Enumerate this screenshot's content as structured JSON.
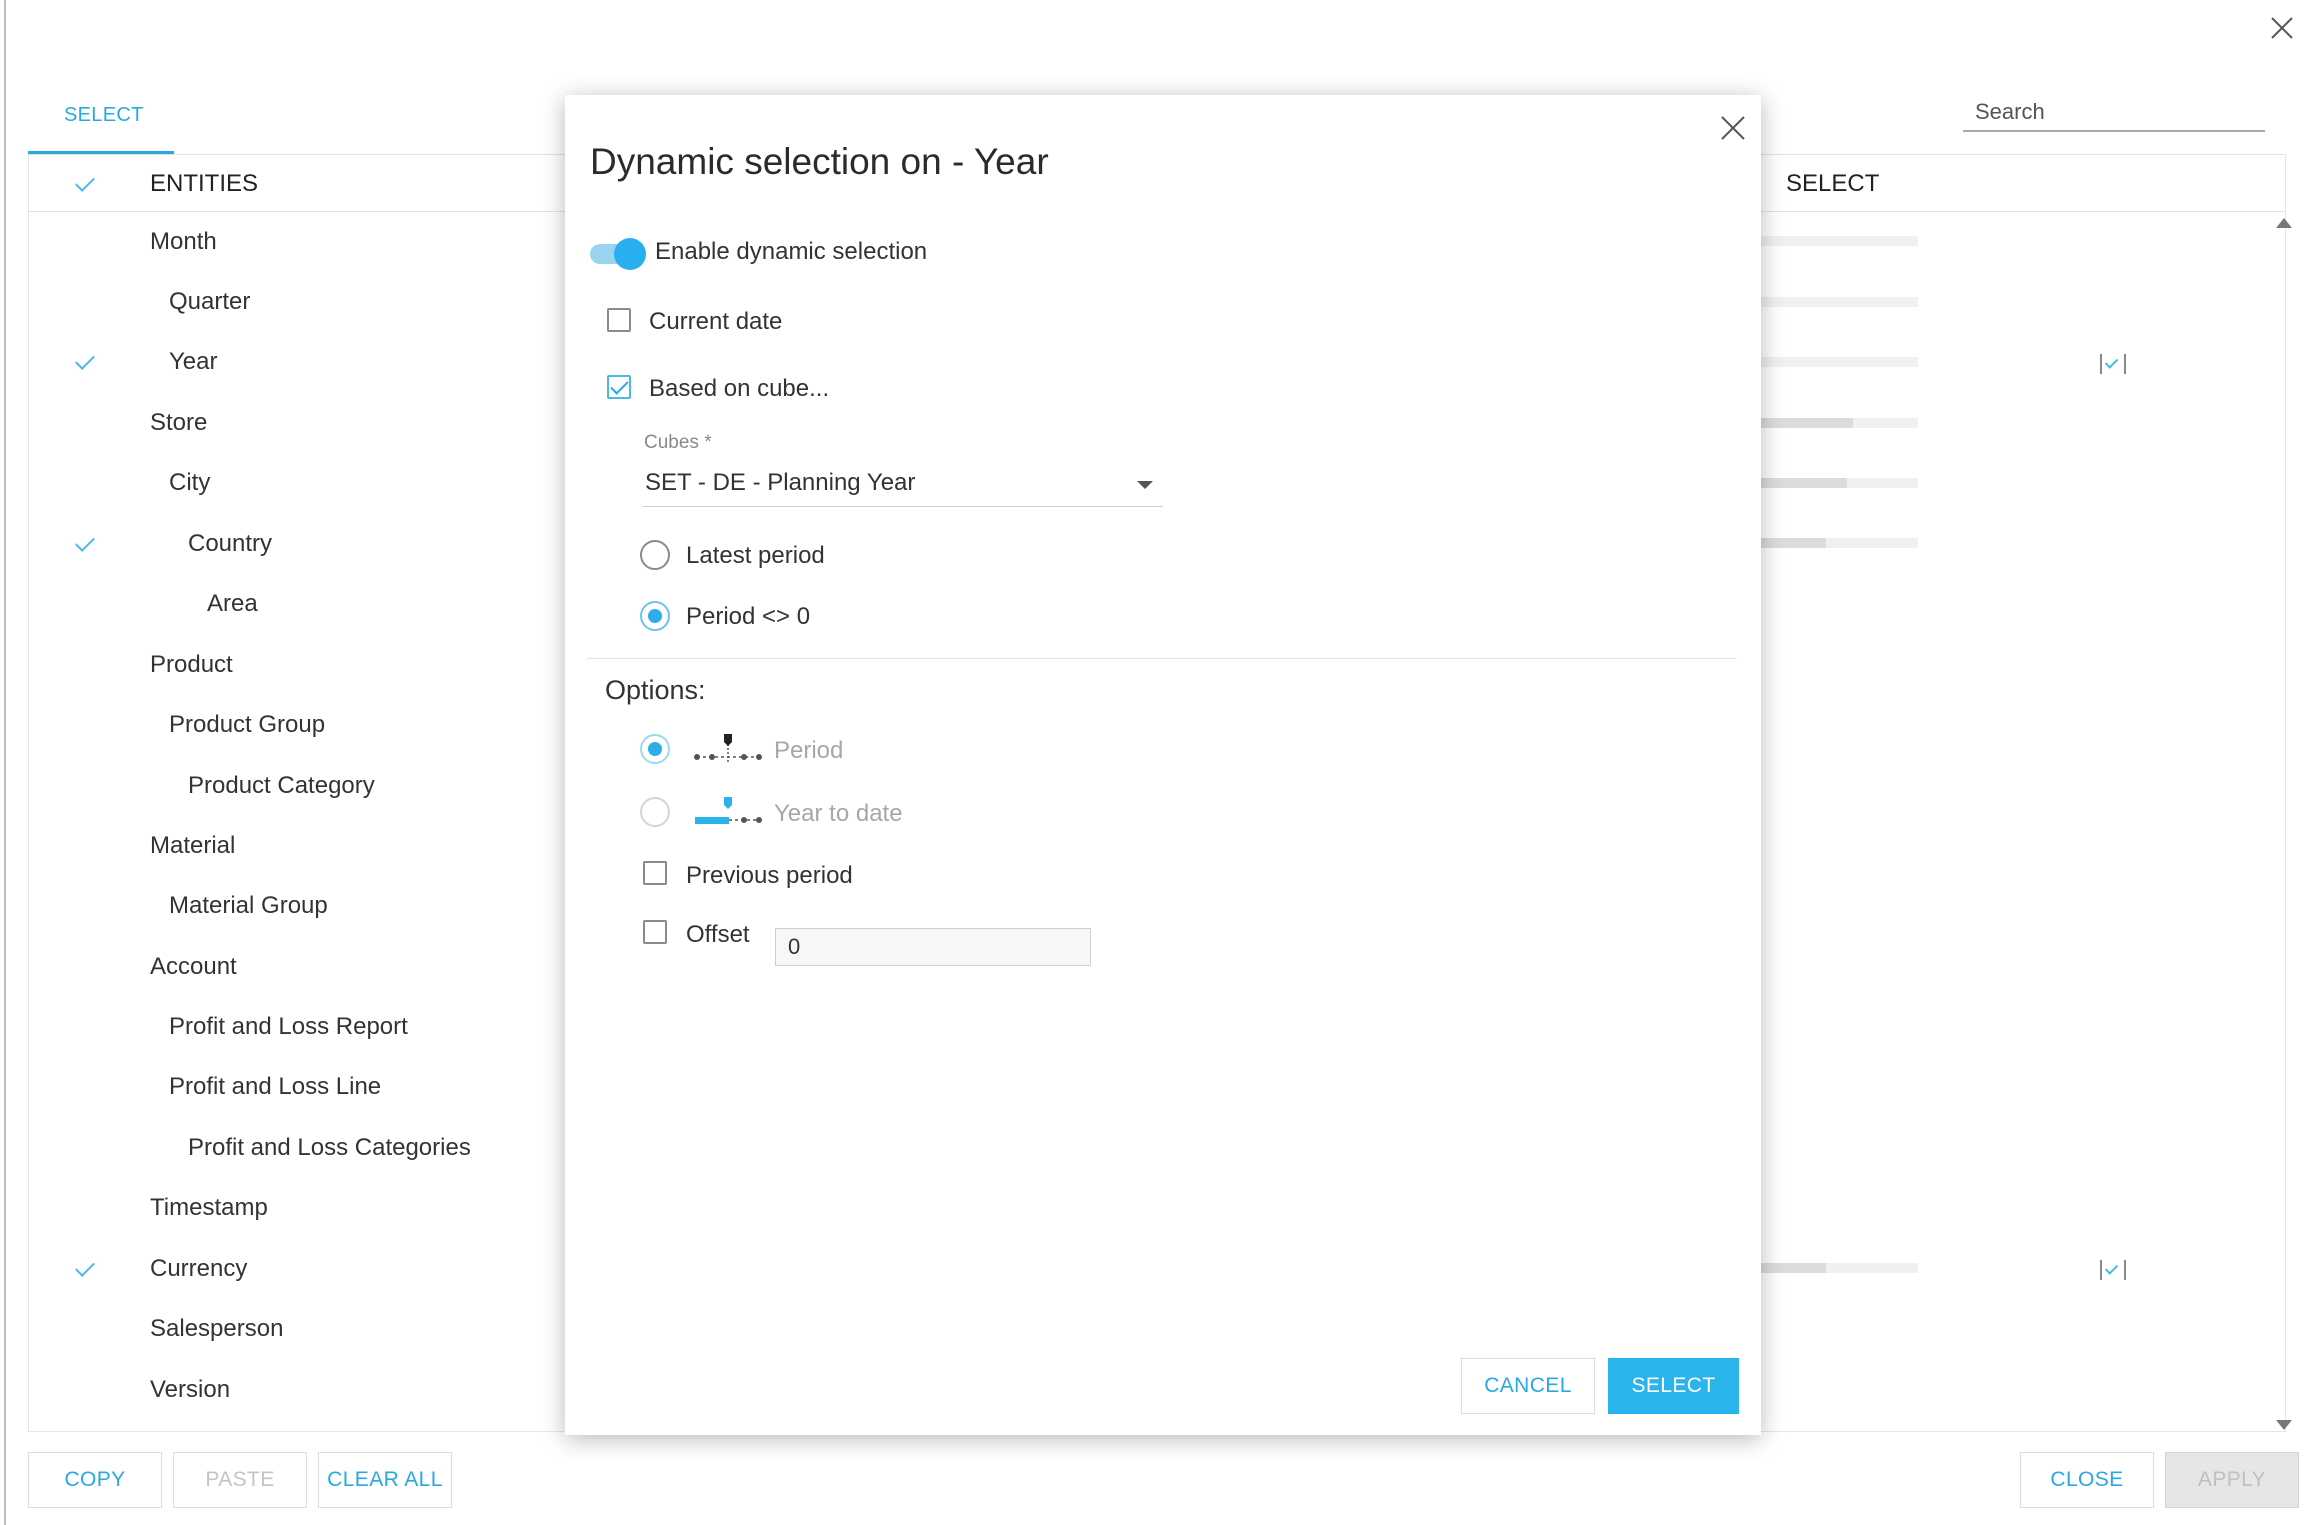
{
  "tabs": {
    "select_label": "SELECT"
  },
  "search": {
    "placeholder": "Search"
  },
  "list": {
    "entities_header": "ENTITIES",
    "select_header": "SELECT",
    "entities": [
      {
        "label": "Month",
        "level": 0,
        "checked": false
      },
      {
        "label": "Quarter",
        "level": 1,
        "checked": false
      },
      {
        "label": "Year",
        "level": 1,
        "checked": true
      },
      {
        "label": "Store",
        "level": 0,
        "checked": false
      },
      {
        "label": "City",
        "level": 1,
        "checked": false
      },
      {
        "label": "Country",
        "level": 2,
        "checked": true
      },
      {
        "label": "Area",
        "level": 3,
        "checked": false
      },
      {
        "label": "Product",
        "level": 0,
        "checked": false
      },
      {
        "label": "Product Group",
        "level": 1,
        "checked": false
      },
      {
        "label": "Product Category",
        "level": 2,
        "checked": false
      },
      {
        "label": "Material",
        "level": 0,
        "checked": false
      },
      {
        "label": "Material Group",
        "level": 1,
        "checked": false
      },
      {
        "label": "Account",
        "level": 0,
        "checked": false
      },
      {
        "label": "Profit and Loss Report",
        "level": 1,
        "checked": false
      },
      {
        "label": "Profit and Loss Line",
        "level": 1,
        "checked": false
      },
      {
        "label": "Profit and Loss Categories",
        "level": 2,
        "checked": false
      },
      {
        "label": "Timestamp",
        "level": 0,
        "checked": false
      },
      {
        "label": "Currency",
        "level": 0,
        "checked": true
      },
      {
        "label": "Salesperson",
        "level": 0,
        "checked": false
      },
      {
        "label": "Version",
        "level": 0,
        "checked": false
      }
    ]
  },
  "footer": {
    "copy": "COPY",
    "paste": "PASTE",
    "clear_all": "CLEAR ALL",
    "close": "CLOSE",
    "apply": "APPLY"
  },
  "modal": {
    "title": "Dynamic selection on - Year",
    "enable_label": "Enable dynamic selection",
    "enable_on": true,
    "current_date_label": "Current date",
    "current_date_checked": false,
    "based_on_cube_label": "Based on cube...",
    "based_on_cube_checked": true,
    "cubes_label": "Cubes *",
    "cubes_value": "SET - DE - Planning Year",
    "latest_period_label": "Latest period",
    "period_ne_zero_label": "Period <> 0",
    "options_title": "Options:",
    "option_period_label": "Period",
    "option_ytd_label": "Year to date",
    "previous_period_label": "Previous period",
    "offset_label": "Offset",
    "offset_value": "0",
    "cancel_label": "CANCEL",
    "select_label": "SELECT"
  },
  "colors": {
    "accent": "#29a9e1",
    "primary_button": "#29b4ec"
  }
}
